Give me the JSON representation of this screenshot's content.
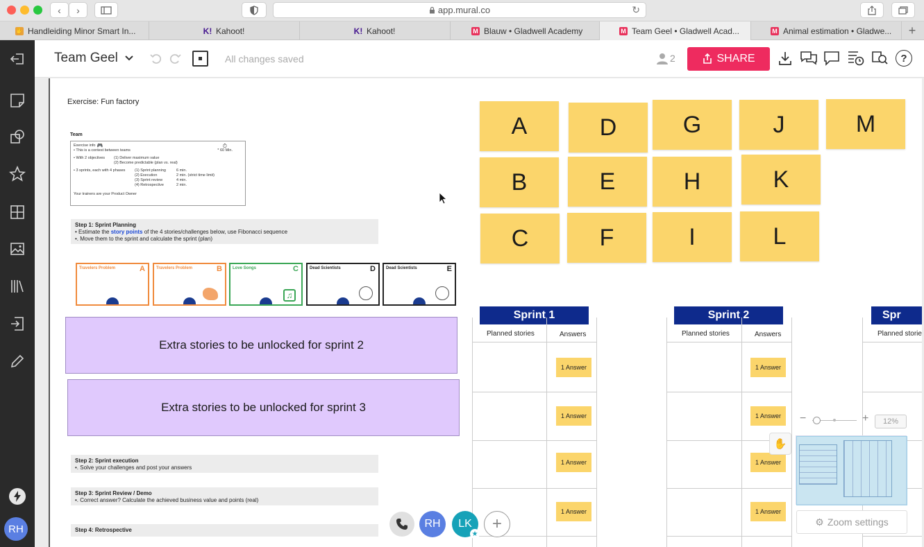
{
  "browser": {
    "url": "app.mural.co",
    "tabs": [
      {
        "label": "Handleiding Minor Smart In...",
        "icon": "hand-icon"
      },
      {
        "label": "Kahoot!",
        "icon": "kahoot-icon"
      },
      {
        "label": "Kahoot!",
        "icon": "kahoot-icon"
      },
      {
        "label": "Blauw • Gladwell Academy",
        "icon": "mural-icon"
      },
      {
        "label": "Team Geel • Gladwell Acad...",
        "icon": "mural-icon"
      },
      {
        "label": "Animal estimation • Gladwe...",
        "icon": "mural-icon"
      }
    ]
  },
  "topbar": {
    "mural_title": "Team Geel",
    "save_status": "All changes saved",
    "collaborators_count": "2",
    "share_label": "SHARE"
  },
  "sidebar": {
    "user_initials": "RH"
  },
  "board": {
    "exercise_title": "Exercise: Fun factory",
    "team_label": "Team",
    "info": {
      "title": "Exercise info",
      "line1": "• This is a contest between teams",
      "minutes": "* 60 Min.",
      "line2": "• With 2 objectives",
      "obj1": "(1)  Deliver maximum value",
      "obj2": "(2)  Become predictable (plan vs. real)",
      "line3": "• 3 sprints, each with 4 phases",
      "phases": [
        "(1) Sprint planning",
        "(2) Execution",
        "(3) Sprint review",
        "(4) Retrospective"
      ],
      "times": [
        "6 min.",
        "2 min. (strict time limit)",
        "4 min.",
        "2 min."
      ],
      "footer": "Your trainers are your Product Owner"
    },
    "step1": {
      "title": "Step 1: Sprint Planning",
      "line1_pre": "•  Estimate the ",
      "line1_em": "story points",
      "line1_post": " of the 4 stories/challenges below, use Fibonacci sequence",
      "line2": "•. Move them to the sprint and calculate the sprint (plan)"
    },
    "cards": [
      {
        "title": "Travelers Problem",
        "letter": "A",
        "color": "#f08a3c"
      },
      {
        "title": "Travelers Problem",
        "letter": "B",
        "color": "#f08a3c"
      },
      {
        "title": "Love Songs",
        "letter": "C",
        "color": "#3aa655"
      },
      {
        "title": "Dead Scientists",
        "letter": "D",
        "color": "#222222"
      },
      {
        "title": "Dead Scientists",
        "letter": "E",
        "color": "#222222"
      }
    ],
    "extra2": "Extra stories to be unlocked for sprint 2",
    "extra3": "Extra stories to be unlocked for sprint 3",
    "step2": {
      "title": "Step 2: Sprint execution",
      "line": "•. Solve your challenges and post your answers"
    },
    "step3": {
      "title": "Step 3: Sprint Review / Demo",
      "line": "•. Correct answer? Calculate the achieved business value and points (real)"
    },
    "step4": {
      "title": "Step 4: Retrospective"
    },
    "stickies": [
      "A",
      "D",
      "G",
      "J",
      "M",
      "B",
      "E",
      "H",
      "K",
      "C",
      "F",
      "I",
      "L"
    ],
    "sprints": [
      {
        "title": "Sprint  1",
        "planned": "Planned stories",
        "answers": "Answers",
        "answer_label": "1 Answer"
      },
      {
        "title": "Sprint  2",
        "planned": "Planned stories",
        "answers": "Answers",
        "answer_label": "1 Answer"
      },
      {
        "title": "Spr",
        "planned": "Planned stories"
      }
    ]
  },
  "zoom": {
    "level": "12%",
    "settings_label": "Zoom settings"
  },
  "call": {
    "avatars": [
      "RH",
      "LK"
    ]
  },
  "colors": {
    "share": "#ee2b5f",
    "sticky": "#fbd56b",
    "purple": "#e0c9fd",
    "sprint": "#0e2a8c"
  }
}
